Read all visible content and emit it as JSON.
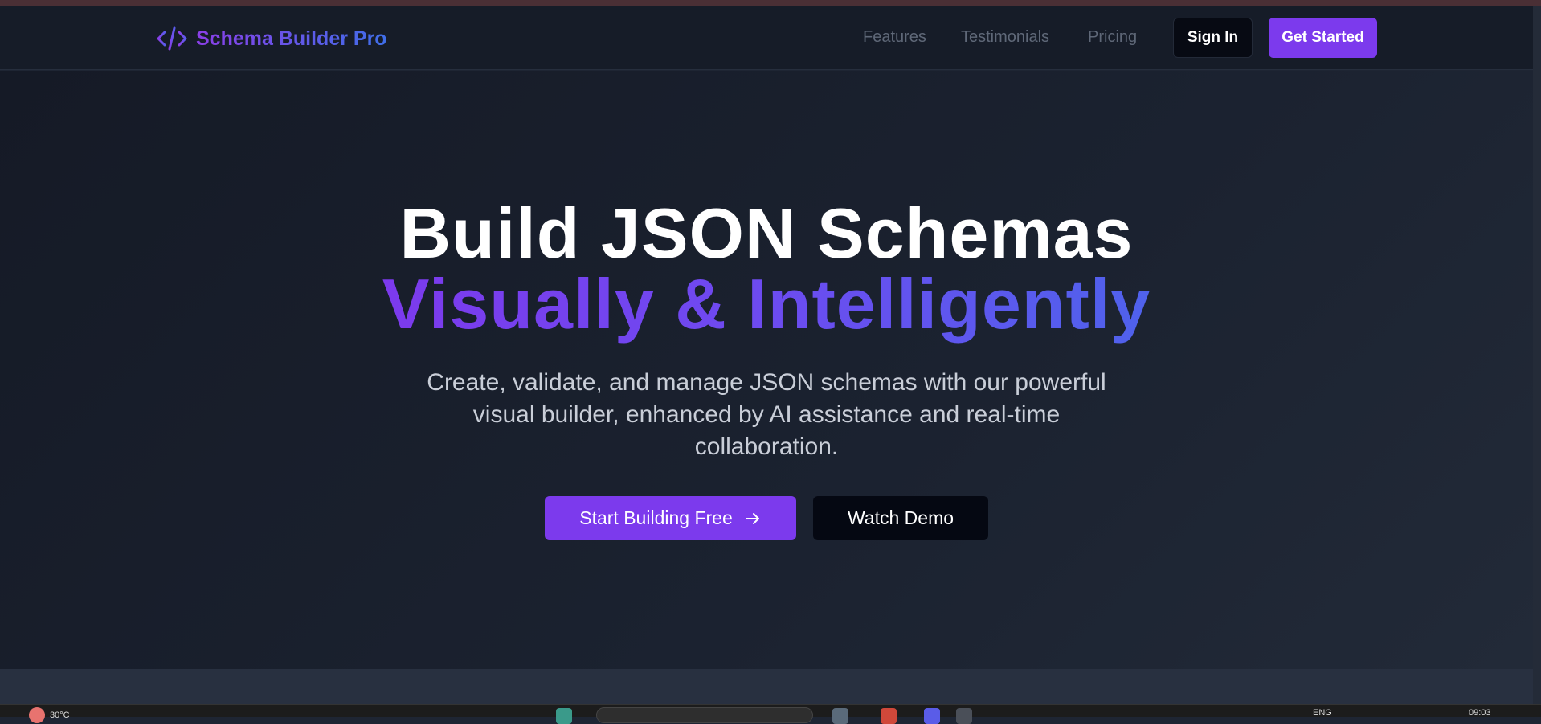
{
  "nav": {
    "brand": "Schema Builder Pro",
    "links": [
      "Features",
      "Testimonials",
      "Pricing"
    ],
    "sign_in": "Sign In",
    "get_started": "Get Started"
  },
  "hero": {
    "title_line1": "Build JSON Schemas",
    "title_line2": "Visually & Intelligently",
    "subtitle_lines": [
      "Create, validate, and manage JSON schemas with our powerful",
      "visual builder, enhanced by AI assistance and real-time",
      "collaboration."
    ],
    "primary_cta": "Start Building Free",
    "secondary_cta": "Watch Demo"
  },
  "taskbar": {
    "weather": "30°C",
    "language": "ENG",
    "clock": "09:03"
  },
  "icons": {
    "brand": "code-icon",
    "cta_arrow": "arrow-right-icon"
  },
  "colors": {
    "accent": "#7c3aed",
    "gradient_end": "#4f62ec",
    "background": "#1b2230"
  }
}
